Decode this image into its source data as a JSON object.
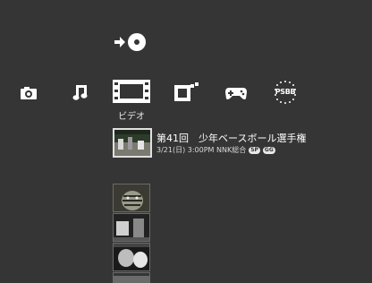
{
  "top_action": {
    "icon": "media-insert-arrow-icon"
  },
  "categories": [
    {
      "id": "photo",
      "icon": "camera-icon"
    },
    {
      "id": "music",
      "icon": "music-note-icon"
    },
    {
      "id": "video",
      "icon": "film-strip-icon",
      "label": "ビデオ",
      "selected": true
    },
    {
      "id": "tv",
      "icon": "tv-icon"
    },
    {
      "id": "game",
      "icon": "gamepad-icon"
    },
    {
      "id": "network",
      "icon": "psbb-network-icon",
      "text": "PSBB"
    }
  ],
  "selected_item": {
    "title": "第41回　少年ベースボール選手権",
    "subtitle": "3/21(日) 3:00PM NNK総合",
    "badges": [
      "SP",
      "GG"
    ]
  }
}
